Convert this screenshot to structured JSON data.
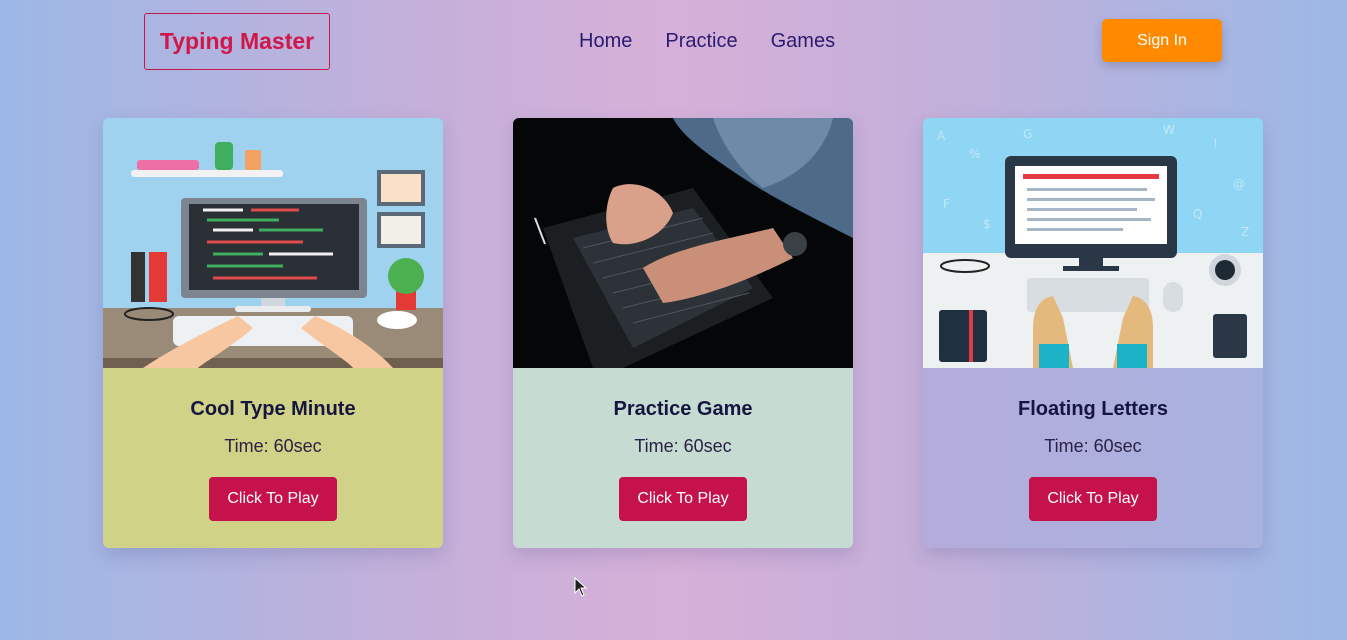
{
  "header": {
    "logo": "Typing Master",
    "nav": [
      "Home",
      "Practice",
      "Games"
    ],
    "signin_label": "Sign In"
  },
  "cards": [
    {
      "title": "Cool Type Minute",
      "time": "Time: 60sec",
      "button": "Click To Play",
      "image": "desk-coding-illustration"
    },
    {
      "title": "Practice Game",
      "time": "Time: 60sec",
      "button": "Click To Play",
      "image": "hands-typing-laptop-photo"
    },
    {
      "title": "Floating Letters",
      "time": "Time: 60sec",
      "button": "Click To Play",
      "image": "computer-desk-topview-illustration"
    }
  ],
  "colors": {
    "logo": "#d0174a",
    "nav": "#2b1b6e",
    "signin": "#ff8a00",
    "play_button": "#c5124a",
    "card1_body": "#d0d287",
    "card2_body": "#c6dbd1",
    "card3_body": "#aeafdd"
  }
}
